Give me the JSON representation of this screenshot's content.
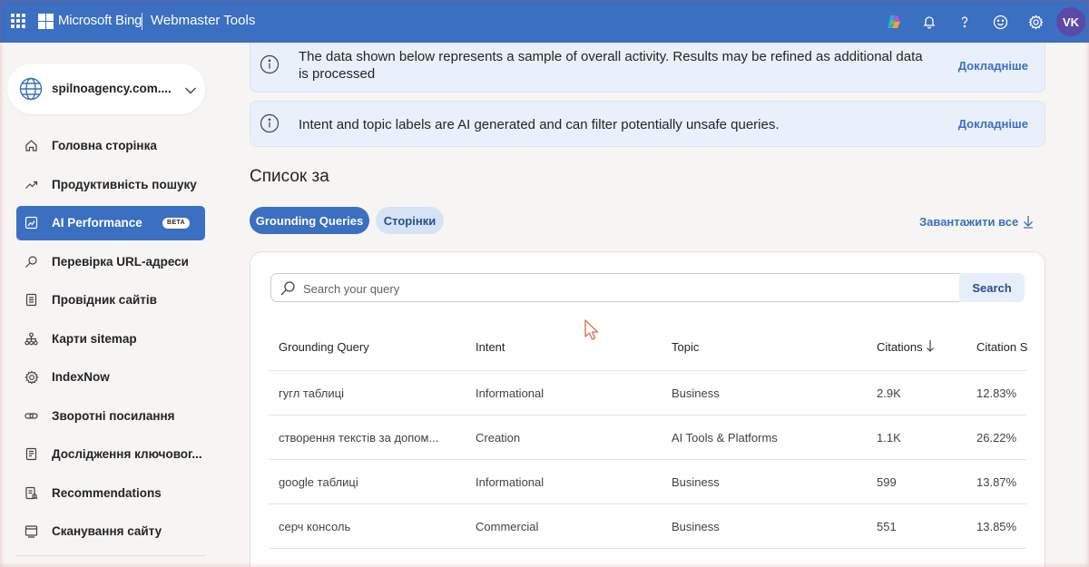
{
  "header": {
    "brand": "Microsoft Bing",
    "product": "Webmaster Tools",
    "avatar_initials": "VK",
    "icons": [
      "app-launcher-icon",
      "copilot-icon",
      "bell-icon",
      "help-icon",
      "feedback-smiley-icon",
      "gear-icon"
    ]
  },
  "sidebar": {
    "site": "spilnoagency.com....",
    "items": [
      {
        "label": "Головна сторінка",
        "icon": "home-icon"
      },
      {
        "label": "Продуктивність пошуку",
        "icon": "trend-icon"
      },
      {
        "label": "AI Performance",
        "icon": "ai-chart-icon",
        "badge": "BETA"
      },
      {
        "label": "Перевірка URL-адреси",
        "icon": "url-search-icon"
      },
      {
        "label": "Провідник сайтів",
        "icon": "document-icon"
      },
      {
        "label": "Карти sitemap",
        "icon": "sitemap-icon"
      },
      {
        "label": "IndexNow",
        "icon": "indexnow-gear-icon"
      },
      {
        "label": "Зворотні посилання",
        "icon": "link-icon"
      },
      {
        "label": "Дослідження ключовог...",
        "icon": "keyword-doc-icon"
      },
      {
        "label": "Recommendations",
        "icon": "recommendations-icon"
      },
      {
        "label": "Сканування сайту",
        "icon": "scan-icon"
      }
    ]
  },
  "banners": [
    {
      "text": "The data shown below represents a sample of overall activity. Results may be refined as additional data is processed",
      "link": "Докладніше"
    },
    {
      "text": "Intent and topic labels are AI generated and can filter potentially unsafe queries.",
      "link": "Докладніше"
    }
  ],
  "main": {
    "section_title": "Список за",
    "tabs": [
      {
        "label": "Grounding Queries",
        "active": true
      },
      {
        "label": "Сторінки",
        "active": false
      }
    ],
    "download_label": "Завантажити все"
  },
  "search": {
    "placeholder": "Search your query",
    "button_label": "Search"
  },
  "table": {
    "columns": [
      "Grounding Query",
      "Intent",
      "Topic",
      "Citations",
      "Citation S"
    ],
    "sorted_column": "Citations",
    "sort_direction": "descending",
    "rows": [
      [
        "гугл таблиці",
        "Informational",
        "Business",
        "2.9K",
        "12.83%"
      ],
      [
        "створення текстів за допом...",
        "Creation",
        "AI Tools & Platforms",
        "1.1K",
        "26.22%"
      ],
      [
        "google таблиці",
        "Informational",
        "Business",
        "599",
        "13.87%"
      ],
      [
        "серч консоль",
        "Commercial",
        "Business",
        "551",
        "13.85%"
      ]
    ]
  },
  "colors": {
    "accent": "#3a6fc1",
    "banner_bg": "#e9f0fb",
    "avatar": "#5b49a8"
  }
}
